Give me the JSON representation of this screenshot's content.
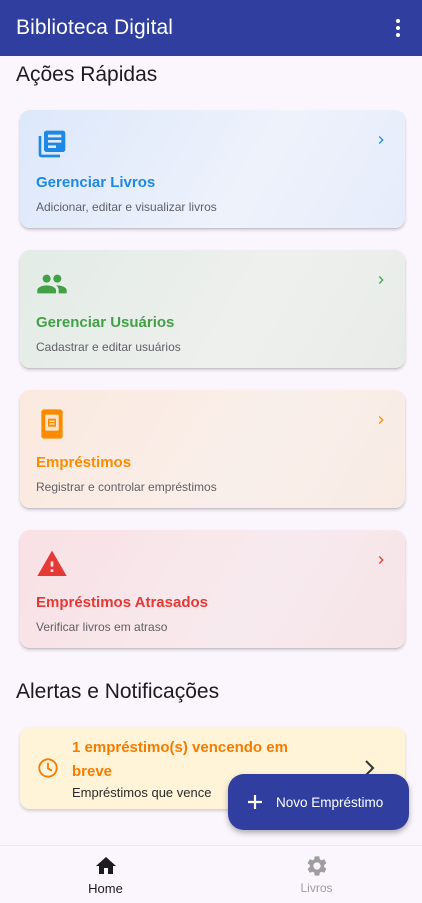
{
  "app_bar": {
    "title": "Biblioteca Digital"
  },
  "quick_actions": {
    "title": "Ações Rápidas",
    "cards": [
      {
        "title": "Gerenciar Livros",
        "subtitle": "Adicionar, editar e visualizar livros",
        "icon": "library-books-icon",
        "color": "#1e88e5"
      },
      {
        "title": "Gerenciar Usuários",
        "subtitle": "Cadastrar e editar usuários",
        "icon": "people-icon",
        "color": "#43a047"
      },
      {
        "title": "Empréstimos",
        "subtitle": "Registrar e controlar empréstimos",
        "icon": "loan-book-icon",
        "color": "#fb8c00"
      },
      {
        "title": "Empréstimos Atrasados",
        "subtitle": "Verificar livros em atraso",
        "icon": "warning-icon",
        "color": "#e53935"
      }
    ]
  },
  "alerts": {
    "title": "Alertas e Notificações",
    "items": [
      {
        "title": "1 empréstimo(s) vencendo em breve",
        "subtitle": "Empréstimos que vence",
        "icon": "clock-icon",
        "color": "#f57c00"
      }
    ]
  },
  "fab": {
    "label": "Novo Empréstimo",
    "icon": "plus-icon"
  },
  "bottom_nav": {
    "items": [
      {
        "label": "Home",
        "icon": "home-icon",
        "active": true
      },
      {
        "label": "Livros",
        "icon": "gear-icon",
        "active": false
      }
    ]
  }
}
